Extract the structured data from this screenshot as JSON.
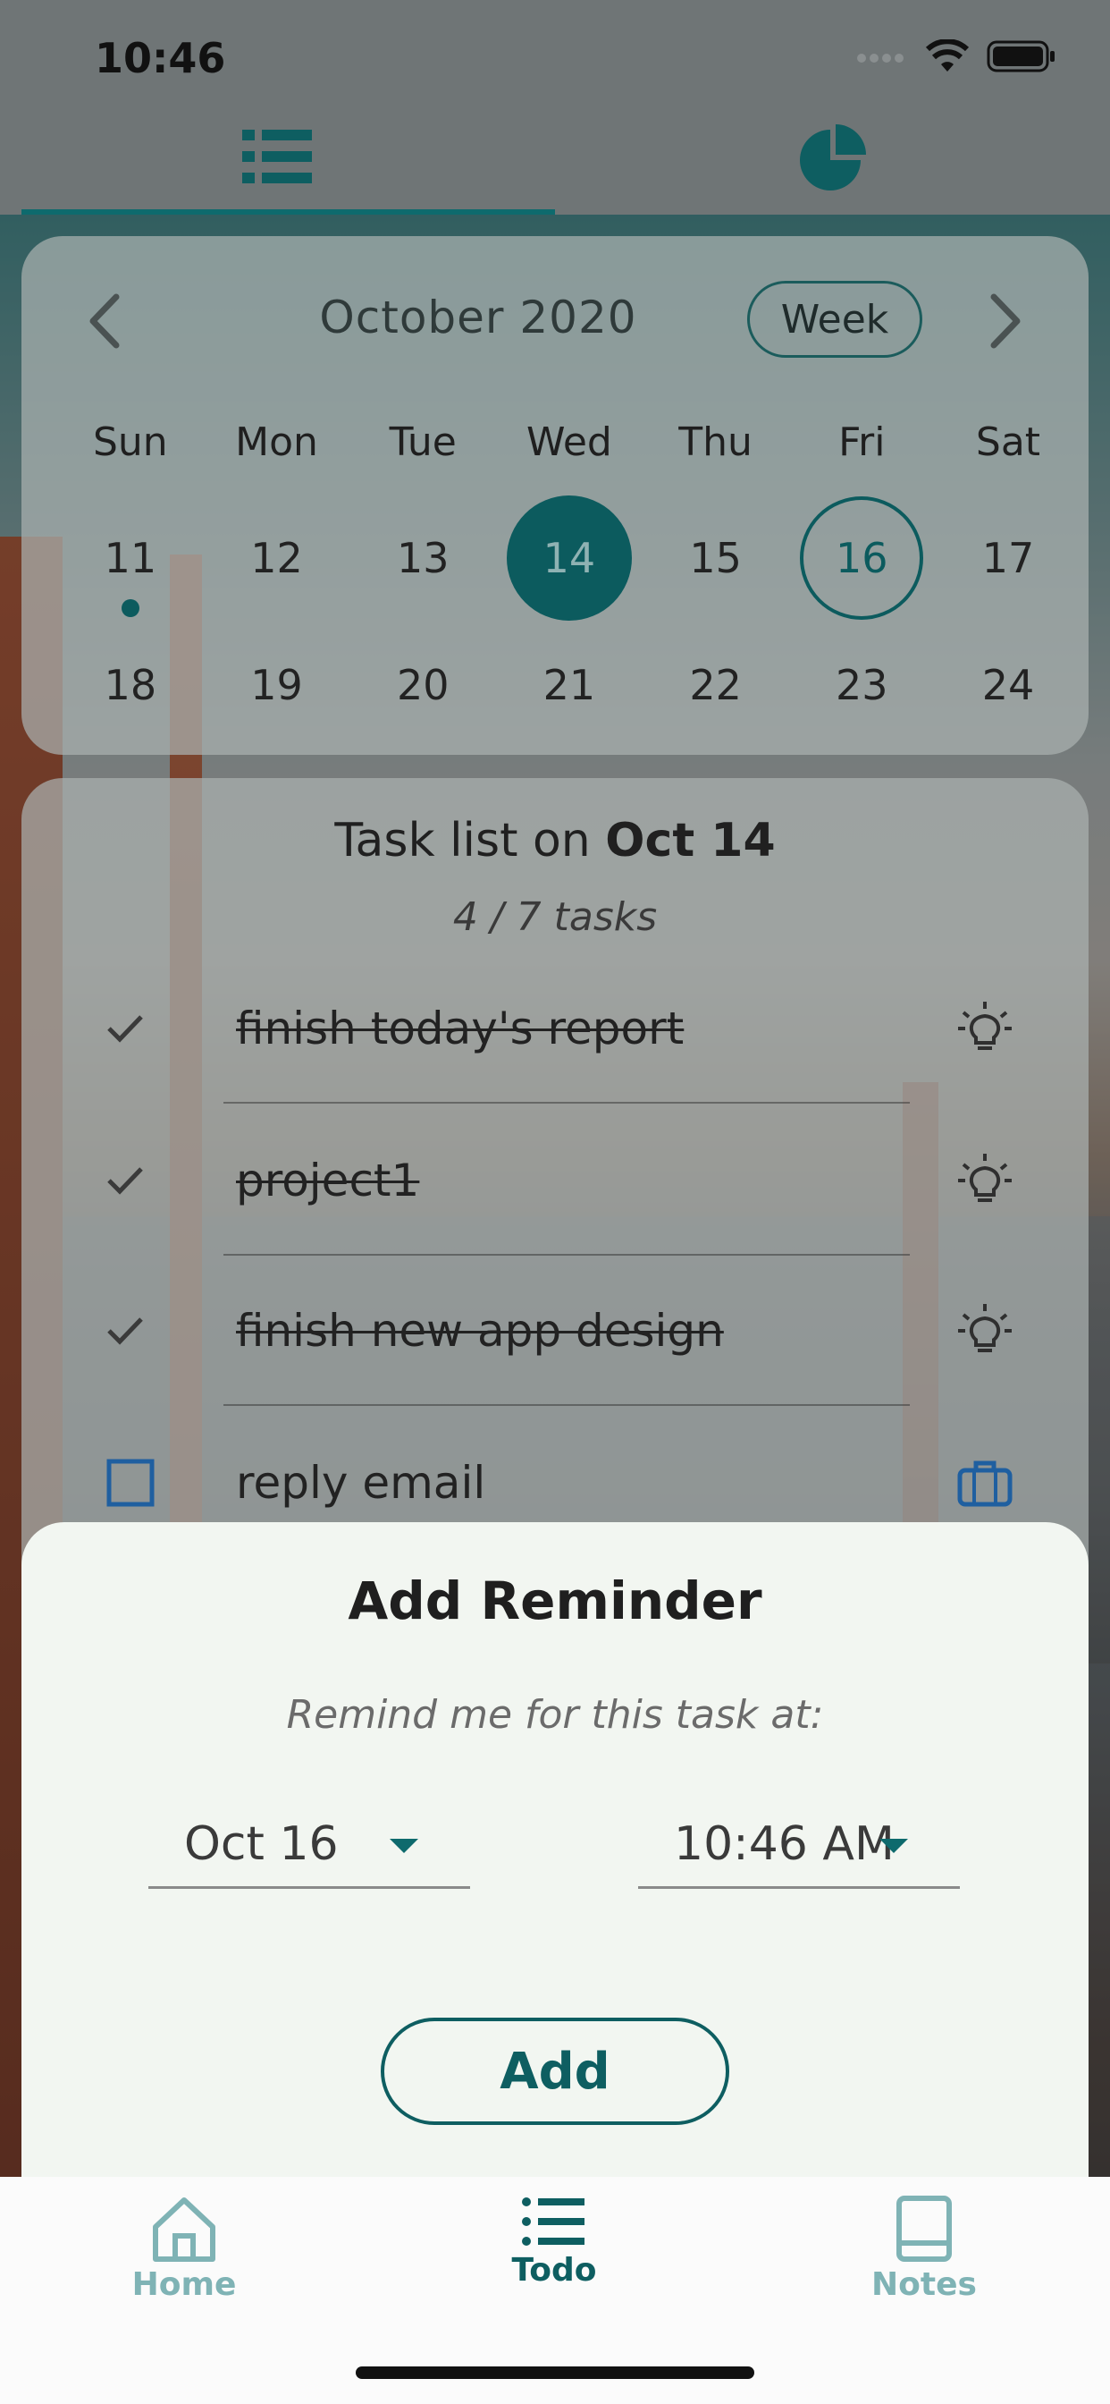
{
  "status_bar": {
    "time": "10:46"
  },
  "top_tabs": [
    {
      "name": "list",
      "icon": "list-icon",
      "active": true
    },
    {
      "name": "chart",
      "icon": "pie-chart-icon",
      "active": false
    }
  ],
  "calendar": {
    "month": "October 2020",
    "view_toggle": "Week",
    "weekdays": [
      "Sun",
      "Mon",
      "Tue",
      "Wed",
      "Thu",
      "Fri",
      "Sat"
    ],
    "week1": [
      "11",
      "12",
      "13",
      "14",
      "15",
      "16",
      "17"
    ],
    "week2": [
      "18",
      "19",
      "20",
      "21",
      "22",
      "23",
      "24"
    ],
    "selected_day": "14",
    "today": "16",
    "event_dot_day": "11"
  },
  "tasks": {
    "title_prefix": "Task list on",
    "title_date": "Oct 14",
    "progress": "4 / 7 tasks",
    "items": [
      {
        "label": "finish today's report",
        "done": true,
        "icon": "lightbulb-icon"
      },
      {
        "label": "project1",
        "done": true,
        "icon": "lightbulb-icon"
      },
      {
        "label": "finish new app design",
        "done": true,
        "icon": "lightbulb-icon"
      },
      {
        "label": "reply email",
        "done": false,
        "icon": "briefcase-icon"
      }
    ]
  },
  "reminder_sheet": {
    "title": "Add Reminder",
    "subtitle": "Remind me for this task at:",
    "date_value": "Oct 16",
    "time_value": "10:46 AM",
    "add_label": "Add"
  },
  "bottom_nav": {
    "items": [
      {
        "label": "Home",
        "icon": "home-icon"
      },
      {
        "label": "Todo",
        "icon": "list-icon"
      },
      {
        "label": "Notes",
        "icon": "notebook-icon"
      }
    ]
  },
  "colors": {
    "accent": "#0e5e61",
    "sheet_bg": "#f2f6f1",
    "nav_inactive": "#7fb3b5"
  }
}
